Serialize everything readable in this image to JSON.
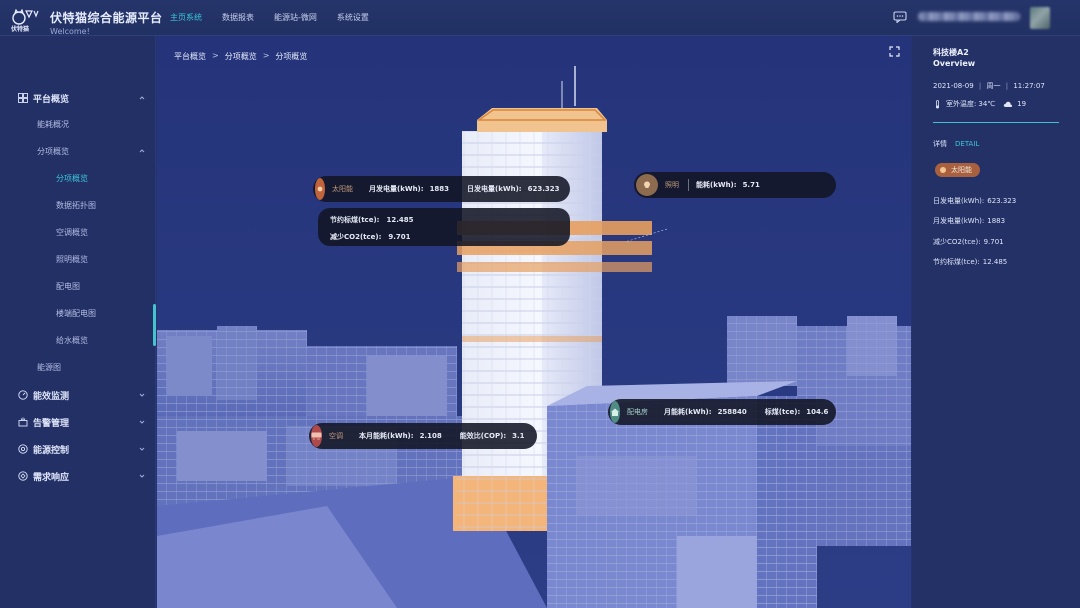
{
  "app": {
    "title": "伏特猫综合能源平台",
    "subtitle": "Welcome!",
    "logo_text": "伏特猫"
  },
  "nav": {
    "items": [
      "主页系统",
      "数据报表",
      "能源站-微网",
      "系统设置"
    ],
    "active_index": 0
  },
  "sidebar": {
    "items": [
      {
        "label": "平台概览",
        "level": 1,
        "icon": "grid-icon",
        "expanded": true
      },
      {
        "label": "能耗概况",
        "level": 2
      },
      {
        "label": "分项概览",
        "level": 2,
        "expanded": true
      },
      {
        "label": "分项概览",
        "level": 3,
        "active": true
      },
      {
        "label": "数据拓扑图",
        "level": 3
      },
      {
        "label": "空调概览",
        "level": 3
      },
      {
        "label": "照明概览",
        "level": 3
      },
      {
        "label": "配电图",
        "level": 3
      },
      {
        "label": "楼端配电图",
        "level": 3
      },
      {
        "label": "给水概览",
        "level": 3
      },
      {
        "label": "能源图",
        "level": 2
      },
      {
        "label": "能效监测",
        "level": 1,
        "icon": "gauge-icon"
      },
      {
        "label": "告警管理",
        "level": 1,
        "icon": "alert-icon"
      },
      {
        "label": "能源控制",
        "level": 1,
        "icon": "control-icon"
      },
      {
        "label": "需求响应",
        "level": 1,
        "icon": "response-icon"
      }
    ]
  },
  "breadcrumb": [
    "平台概览",
    "分项概览",
    "分项概览"
  ],
  "breadcrumb_sep": ">",
  "callouts": {
    "solar": {
      "name": "太阳能",
      "k1": "月发电量(kWh):",
      "v1": "1883",
      "k2": "日发电量(kWh):",
      "v2": "623.323",
      "icon": "sun-icon",
      "color": "#c0643c"
    },
    "solar_stats": {
      "k1": "节约标煤(tce):",
      "v1": "12.485",
      "k2": "减少CO2(tce):",
      "v2": "9.701"
    },
    "lighting": {
      "name": "照明",
      "k1": "能耗(kWh):",
      "v1": "5.71",
      "icon": "bulb-icon",
      "color": "#8c6b4e"
    },
    "hvac": {
      "name": "空调",
      "k1": "本月能耗(kWh):",
      "v1": "2.108",
      "k2": "能效比(COP):",
      "v2": "3.1",
      "icon": "ac-icon",
      "color": "#b04a4a"
    },
    "power_room": {
      "name": "配电房",
      "k1": "月能耗(kWh):",
      "v1": "258840",
      "k2": "标煤(tce):",
      "v2": "104.6",
      "icon": "house-icon",
      "color": "#4e8c84"
    }
  },
  "right_panel": {
    "building": "科技楼A2",
    "overview": "Overview",
    "date": "2021-08-09",
    "weekday": "周一",
    "time": "11:27:07",
    "temp_label": "室外温度:",
    "temp": "34℃",
    "weather_value": "19",
    "detail_label": "详情",
    "detail_en": "DETAIL",
    "tag": "太阳能",
    "rows": [
      {
        "k": "日发电量(kWh):",
        "v": "623.323"
      },
      {
        "k": "月发电量(kWh):",
        "v": "1883"
      },
      {
        "k": "减少CO2(tce):",
        "v": "9.701"
      },
      {
        "k": "节约标煤(tce):",
        "v": "12.485"
      }
    ]
  },
  "colors": {
    "accent": "#3bc6d6",
    "sidebar_bg": "#233066",
    "scene_bg": "#2a3a7a",
    "building_orange": "#e8a060"
  }
}
